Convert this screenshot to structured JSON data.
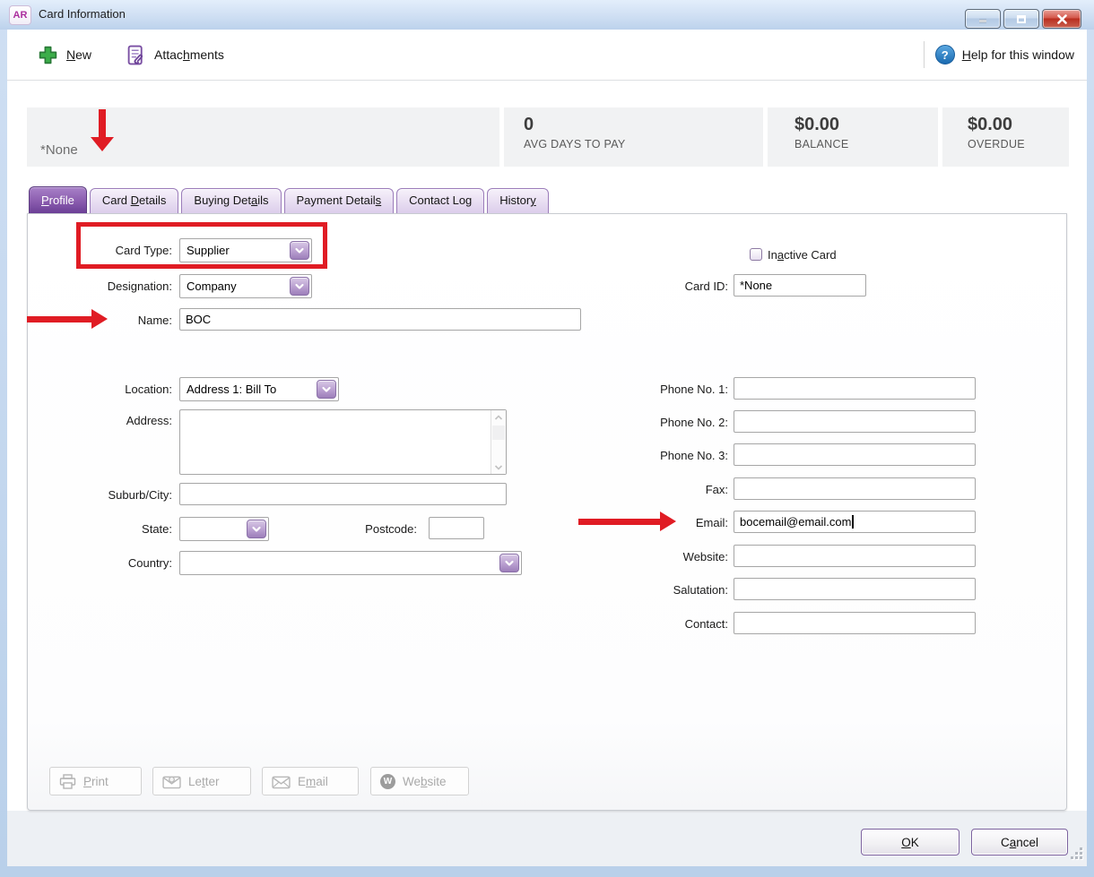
{
  "window": {
    "title": "Card Information",
    "icon_text": "AR"
  },
  "toolbar": {
    "new_label": "New",
    "new_accel": 0,
    "attachments_label": "Attachments",
    "attachments_accel": 5,
    "help_label": "Help for this window",
    "help_accel": 0
  },
  "summary": {
    "card_name": "*None",
    "avg_days_value": "0",
    "avg_days_label": "AVG DAYS TO PAY",
    "balance_value": "$0.00",
    "balance_label": "BALANCE",
    "overdue_value": "$0.00",
    "overdue_label": "OVERDUE"
  },
  "tabs": [
    {
      "label": "Profile",
      "accel": 0
    },
    {
      "label": "Card Details",
      "accel": 5
    },
    {
      "label": "Buying Details",
      "accel": 10
    },
    {
      "label": "Payment Details",
      "accel": 14
    },
    {
      "label": "Contact Log",
      "accel": 10
    },
    {
      "label": "History",
      "accel": 6
    }
  ],
  "form": {
    "card_type": {
      "label": "Card Type:",
      "value": "Supplier"
    },
    "designation": {
      "label": "Designation:",
      "value": "Company"
    },
    "name": {
      "label": "Name:",
      "value": "BOC"
    },
    "inactive": {
      "label": "Inactive Card",
      "accel": 2,
      "checked": false
    },
    "card_id": {
      "label": "Card ID:",
      "value": "*None"
    },
    "location": {
      "label": "Location:",
      "value": "Address 1: Bill To"
    },
    "address": {
      "label": "Address:",
      "value": ""
    },
    "suburb": {
      "label": "Suburb/City:",
      "value": ""
    },
    "state": {
      "label": "State:",
      "value": ""
    },
    "postcode": {
      "label": "Postcode:",
      "value": ""
    },
    "country": {
      "label": "Country:",
      "value": ""
    },
    "phone1": {
      "label": "Phone No. 1:",
      "value": ""
    },
    "phone2": {
      "label": "Phone No. 2:",
      "value": ""
    },
    "phone3": {
      "label": "Phone No. 3:",
      "value": ""
    },
    "fax": {
      "label": "Fax:",
      "value": ""
    },
    "email": {
      "label": "Email:",
      "value": "bocemail@email.com"
    },
    "website": {
      "label": "Website:",
      "value": ""
    },
    "salutation": {
      "label": "Salutation:",
      "value": ""
    },
    "contact": {
      "label": "Contact:",
      "value": ""
    }
  },
  "actions": {
    "print": {
      "label": "Print",
      "accel": 0
    },
    "letter": {
      "label": "Letter",
      "accel": 2
    },
    "email": {
      "label": "Email",
      "accel": 1
    },
    "website": {
      "label": "Website",
      "accel": 2
    }
  },
  "footer": {
    "ok": {
      "label": "OK",
      "accel": 0
    },
    "cancel": {
      "label": "Cancel",
      "accel": 1
    }
  },
  "colors": {
    "accent_purple": "#7a529e",
    "annotation_red": "#e01c24",
    "help_blue": "#1a6ab0",
    "new_green": "#3cae4a",
    "close_red": "#b92e1f"
  }
}
